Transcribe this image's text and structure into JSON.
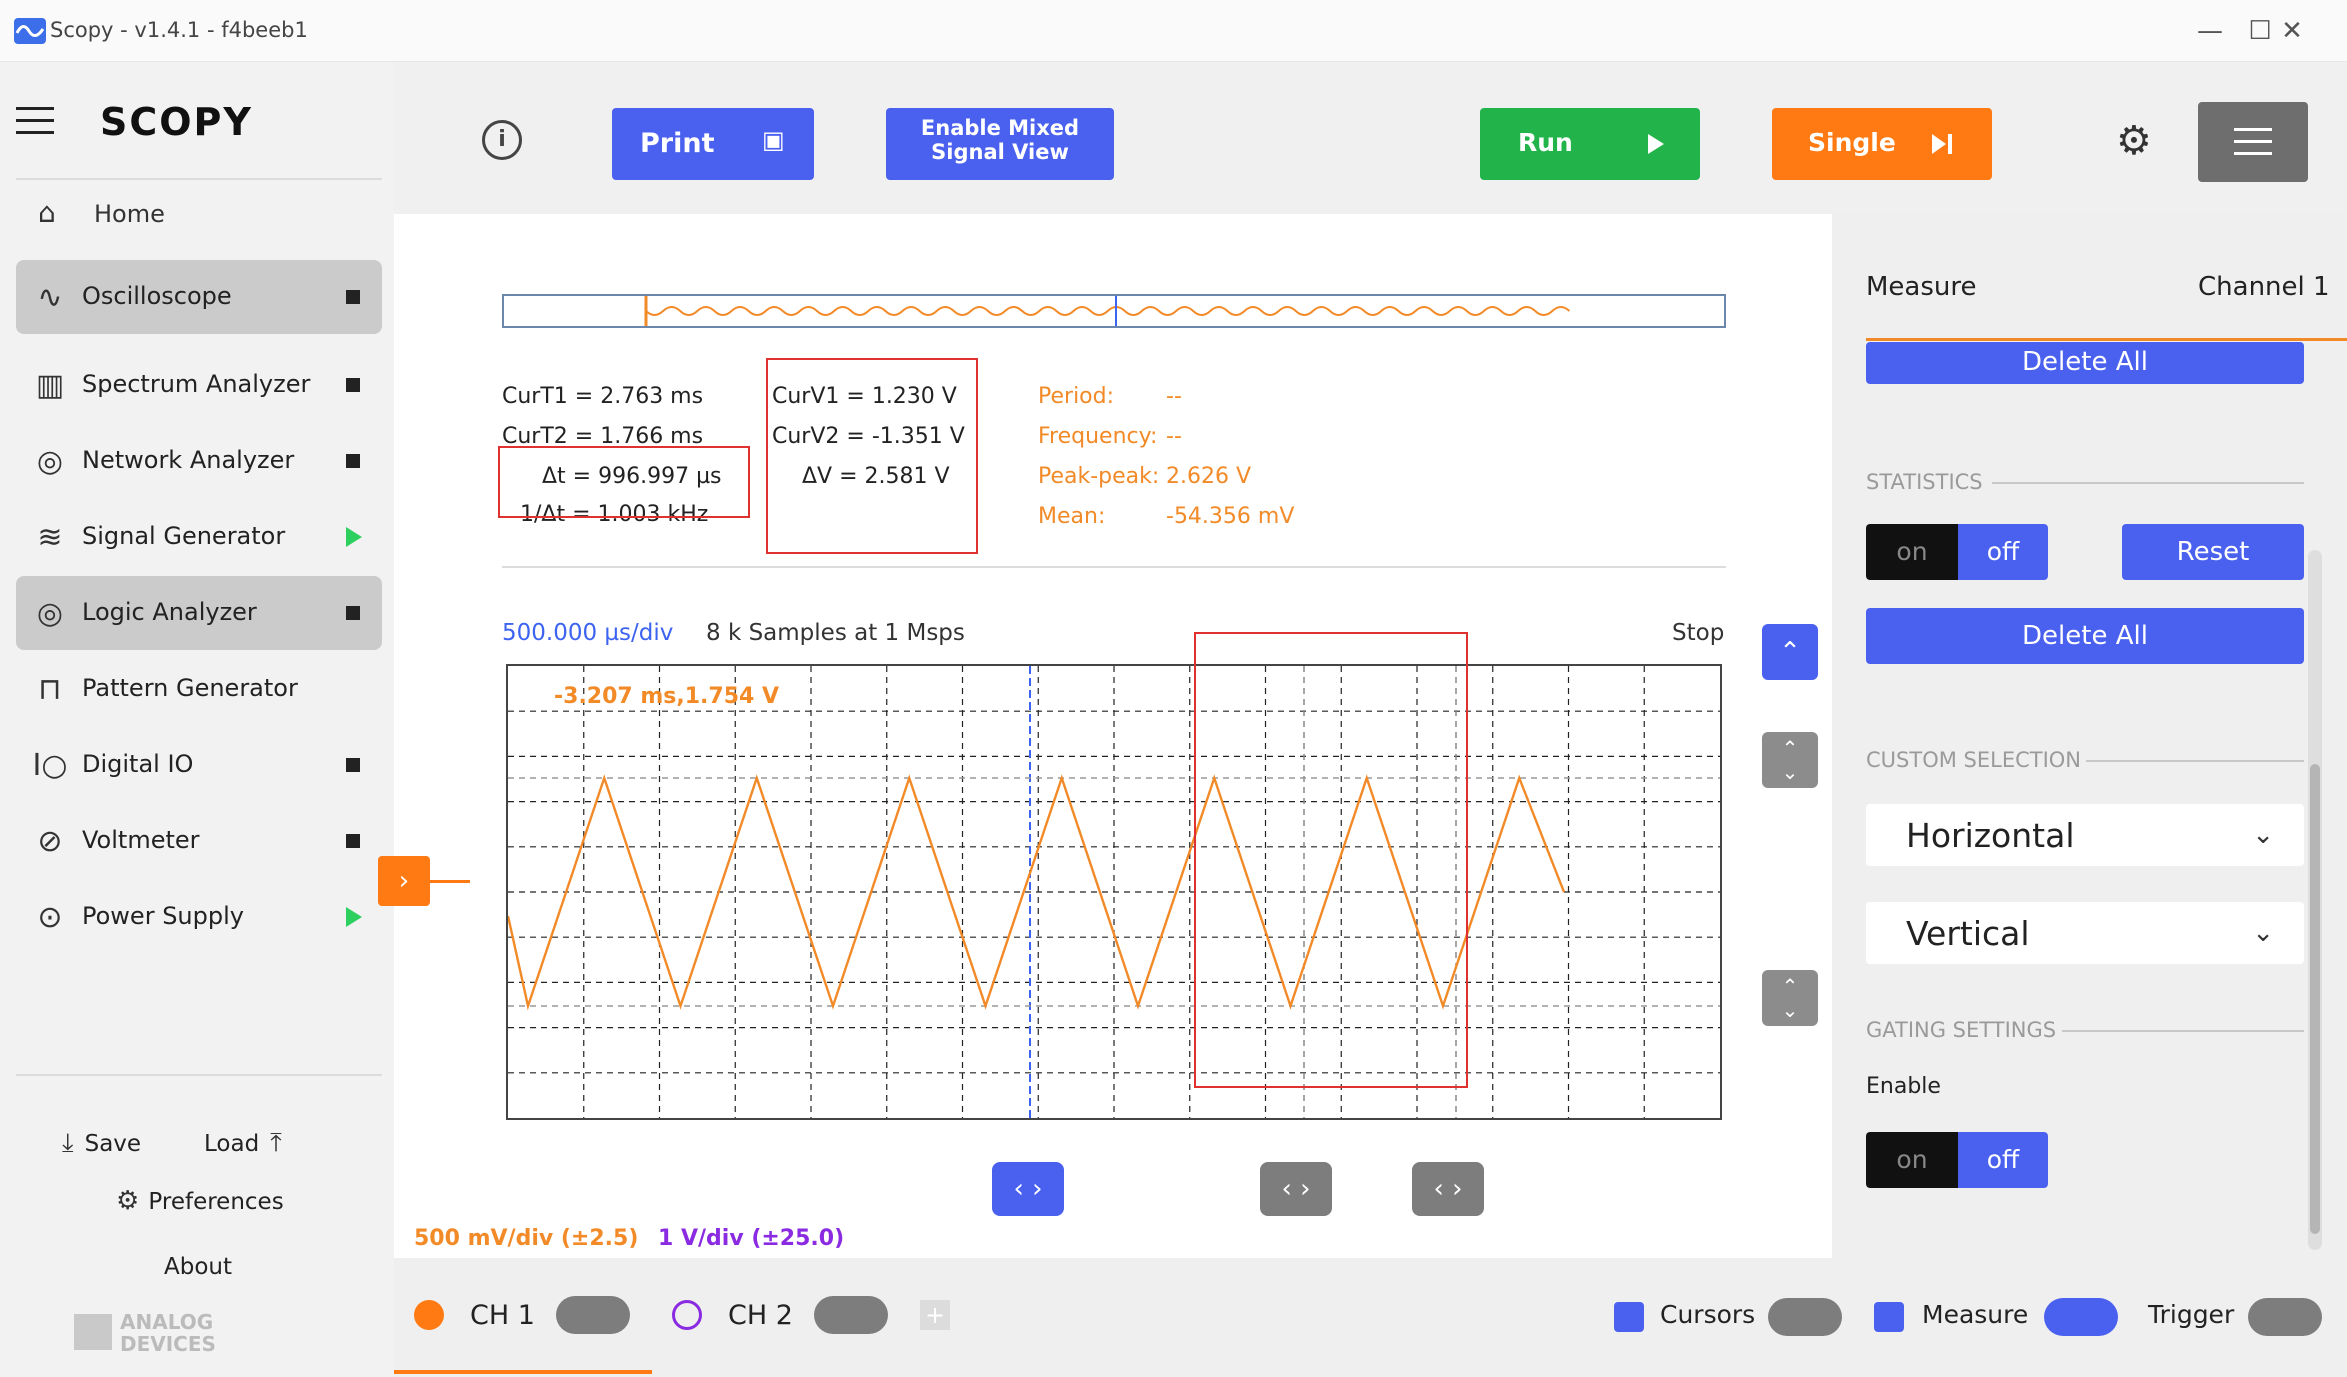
{
  "window": {
    "title": "Scopy - v1.4.1 - f4beeb1",
    "minimize": "—",
    "maximize": "☐",
    "close": "✕"
  },
  "sidebar": {
    "logo": "SCOPY",
    "home": "Home",
    "items": [
      {
        "label": "Oscilloscope",
        "icon": "oscilloscope-icon",
        "status": "stop",
        "active": true
      },
      {
        "label": "Spectrum Analyzer",
        "icon": "spectrum-icon",
        "status": "stop",
        "active": false
      },
      {
        "label": "Network Analyzer",
        "icon": "network-icon",
        "status": "stop",
        "active": false
      },
      {
        "label": "Signal Generator",
        "icon": "signal-icon",
        "status": "play",
        "active": false
      },
      {
        "label": "Logic Analyzer",
        "icon": "logic-icon",
        "status": "stop",
        "active": true
      },
      {
        "label": "Pattern Generator",
        "icon": "pattern-icon",
        "status": "none",
        "active": false
      },
      {
        "label": "Digital IO",
        "icon": "digitalio-icon",
        "status": "stop",
        "active": false
      },
      {
        "label": "Voltmeter",
        "icon": "voltmeter-icon",
        "status": "stop",
        "active": false
      },
      {
        "label": "Power Supply",
        "icon": "power-icon",
        "status": "play",
        "active": false
      }
    ],
    "save": "Save",
    "load": "Load",
    "preferences": "Preferences",
    "about": "About",
    "vendor_line1": "ANALOG",
    "vendor_line2": "DEVICES"
  },
  "toolbar": {
    "print": "Print",
    "mixed_line1": "Enable Mixed",
    "mixed_line2": "Signal View",
    "run": "Run",
    "single": "Single"
  },
  "readouts": {
    "curt1": "CurT1 =  2.763 ms",
    "curt2": "CurT2 = 1.766 ms",
    "dt": "Δt =  996.997 µs",
    "inv_dt": "1/Δt = 1.003 kHz",
    "curv1": "CurV1 =  1.230 V",
    "curv2": "CurV2 = -1.351 V",
    "dv": "ΔV =   2.581 V",
    "period_label": "Period:",
    "period_val": "--",
    "freq_label": "Frequency:",
    "freq_val": "--",
    "pp_label": "Peak-peak:",
    "pp_val": "2.626 V",
    "mean_label": "Mean:",
    "mean_val": "-54.356 mV"
  },
  "plot": {
    "timebase": "500.000 µs/div",
    "samples": "8 k Samples at 1 Msps",
    "status": "Stop",
    "marker": "-3.207 ms,1.754 V",
    "ch1_scale": "500 mV/div (±2.5)",
    "ch2_scale": "1 V/div (±25.0)",
    "wave_peaks": 7,
    "wave_max_v": 1.313,
    "wave_min_v": -1.313
  },
  "right_panel": {
    "measure": "Measure",
    "channel": "Channel 1",
    "delete_all": "Delete All",
    "statistics": "STATISTICS",
    "on": "on",
    "off": "off",
    "reset": "Reset",
    "custom_selection": "CUSTOM SELECTION",
    "horizontal": "Horizontal",
    "vertical": "Vertical",
    "gating": "GATING SETTINGS",
    "enable": "Enable"
  },
  "bottom_bar": {
    "ch1": "CH 1",
    "ch2": "CH 2",
    "cursors": "Cursors",
    "measure": "Measure",
    "trigger": "Trigger"
  },
  "colors": {
    "ch1": "#f28a28",
    "ch2": "#8a2be2",
    "accent_blue": "#4a61f0",
    "run_green": "#22b44a",
    "single_orange": "#ff7a12"
  }
}
